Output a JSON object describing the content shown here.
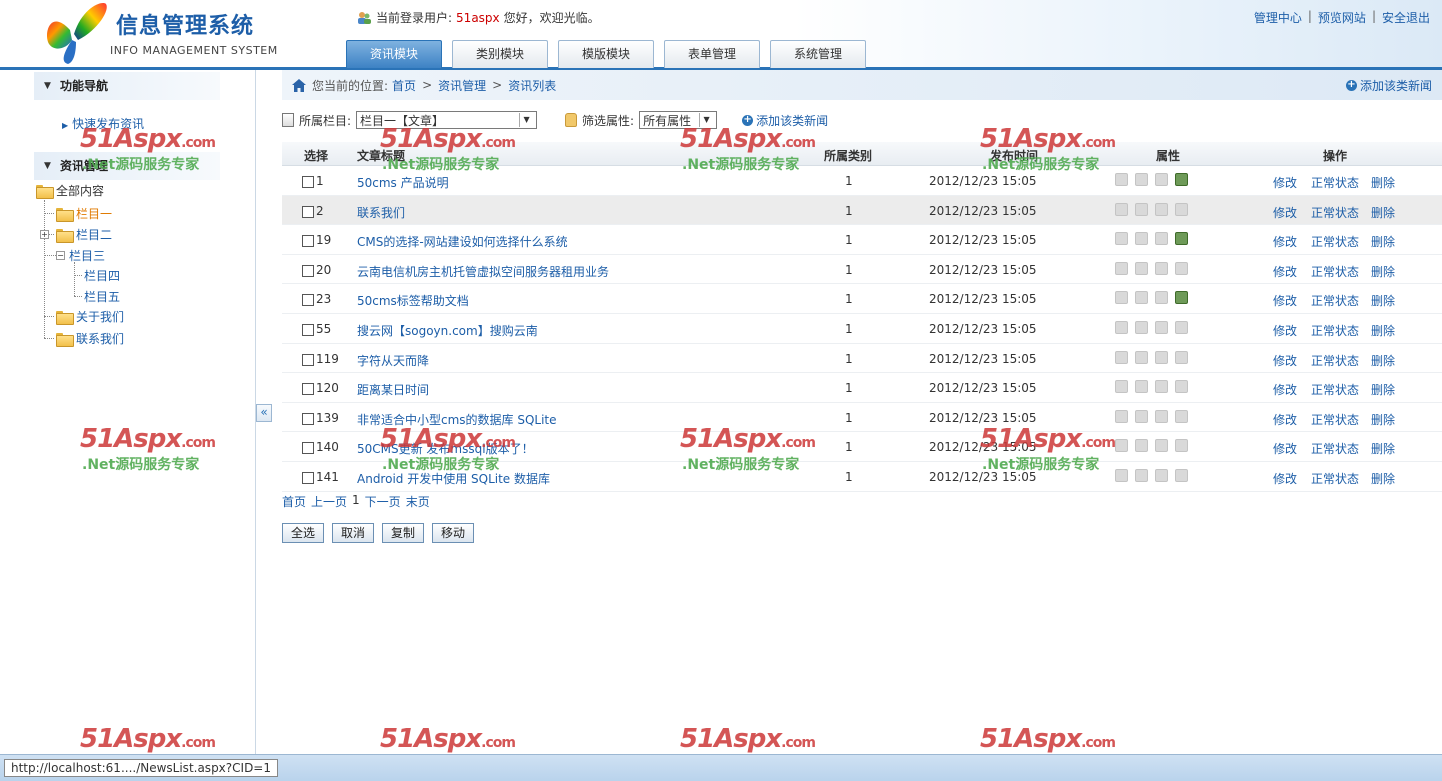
{
  "header": {
    "logo_title": "信息管理系统",
    "logo_subtitle": "INFO MANAGEMENT SYSTEM",
    "user_label": "当前登录用户:",
    "user_name": "51aspx",
    "user_greeting": "您好，欢迎光临。",
    "links": [
      "管理中心",
      "预览网站",
      "安全退出"
    ],
    "link_sep": "|",
    "tabs": [
      {
        "label": "资讯模块",
        "active": true
      },
      {
        "label": "类别模块",
        "active": false
      },
      {
        "label": "模版模块",
        "active": false
      },
      {
        "label": "表单管理",
        "active": false
      },
      {
        "label": "系统管理",
        "active": false
      }
    ]
  },
  "sidebar": {
    "nav_title": "功能导航",
    "quick_publish": "快速发布资讯",
    "section_title": "资讯管理",
    "tree": {
      "root": "全部内容",
      "c1": "栏目一",
      "c2": "栏目二",
      "c3": "栏目三",
      "c4": "栏目四",
      "c5": "栏目五",
      "c6": "关于我们",
      "c7": "联系我们"
    },
    "collapse_glyph": "«"
  },
  "breadcrumb": {
    "prefix": "您当前的位置:",
    "items": [
      "首页",
      "资讯管理",
      "资讯列表"
    ],
    "sep": ">",
    "add_label": "添加该类新闻"
  },
  "filter": {
    "column_label": "所属栏目:",
    "column_value": "栏目一【文章】",
    "attr_label": "筛选属性:",
    "attr_value": "所有属性",
    "add_label": "添加该类新闻"
  },
  "table": {
    "headers": {
      "select": "选择",
      "title": "文章标题",
      "category": "所属类别",
      "time": "发布时间",
      "attr": "属性",
      "ops": "操作"
    },
    "ops": {
      "edit": "修改",
      "status": "正常状态",
      "delete": "删除"
    },
    "rows": [
      {
        "id": "1",
        "title": "50cms 产品说明",
        "category": "1",
        "time": "2012/12/23 15:05"
      },
      {
        "id": "2",
        "title": "联系我们",
        "category": "1",
        "time": "2012/12/23 15:05"
      },
      {
        "id": "19",
        "title": "CMS的选择-网站建设如何选择什么系统",
        "category": "1",
        "time": "2012/12/23 15:05"
      },
      {
        "id": "20",
        "title": "云南电信机房主机托管虚拟空间服务器租用业务",
        "category": "1",
        "time": "2012/12/23 15:05"
      },
      {
        "id": "23",
        "title": "50cms标签帮助文档",
        "category": "1",
        "time": "2012/12/23 15:05"
      },
      {
        "id": "55",
        "title": "搜云网【sogoyn.com】搜购云南",
        "category": "1",
        "time": "2012/12/23 15:05"
      },
      {
        "id": "119",
        "title": "字符从天而降",
        "category": "1",
        "time": "2012/12/23 15:05"
      },
      {
        "id": "120",
        "title": "距离某日时间",
        "category": "1",
        "time": "2012/12/23 15:05"
      },
      {
        "id": "139",
        "title": "非常适合中小型cms的数据库 SQLite",
        "category": "1",
        "time": "2012/12/23 15:05"
      },
      {
        "id": "140",
        "title": "50CMS更新 发布mssql版本了！",
        "category": "1",
        "time": "2012/12/23 15:05"
      },
      {
        "id": "141",
        "title": "Android 开发中使用 SQLite 数据库",
        "category": "1",
        "time": "2012/12/23 15:05"
      }
    ]
  },
  "pager": {
    "first": "首页",
    "prev": "上一页",
    "current": "1",
    "next": "下一页",
    "last": "末页"
  },
  "buttons": {
    "select_all": "全选",
    "cancel": "取消",
    "copy": "复制",
    "move": "移动"
  },
  "statusbar": {
    "url": "http://localhost:61..../NewsList.aspx?CID=1"
  },
  "watermark": {
    "brand": "51Aspx",
    "domain": ".com",
    "slogan": ".Net源码服务专家"
  },
  "colors": {
    "accent": "#2a73b7",
    "link": "#1d5ea8",
    "user": "#cc0000",
    "folder": "#f2c04b",
    "selected": "#e07a00"
  }
}
